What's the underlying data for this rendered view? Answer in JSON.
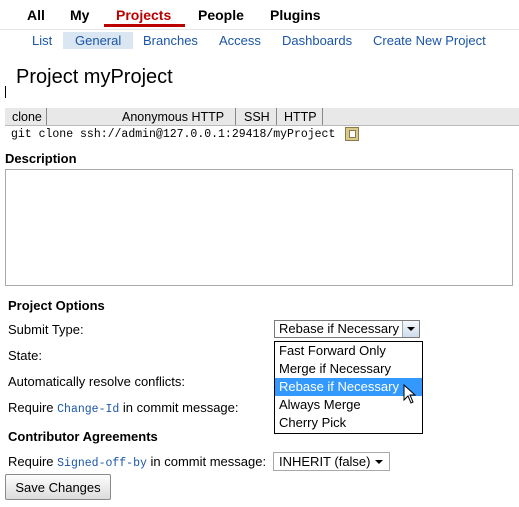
{
  "topnav": {
    "tabs": [
      "All",
      "My",
      "Projects",
      "People",
      "Plugins"
    ],
    "active": "Projects"
  },
  "subnav": {
    "items": [
      "List",
      "General",
      "Branches",
      "Access",
      "Dashboards",
      "Create New Project"
    ],
    "active": "General"
  },
  "page_title": "Project myProject",
  "download": {
    "clone_label": "clone",
    "schemes": [
      "Anonymous HTTP",
      "SSH",
      "HTTP"
    ],
    "command": "git clone ssh://admin@127.0.0.1:29418/myProject",
    "copy_icon": "copy-clipboard-icon"
  },
  "description": {
    "label": "Description",
    "value": ""
  },
  "project_options": {
    "heading": "Project Options",
    "submit_type_label": "Submit Type:",
    "submit_type_value": "Rebase if Necessary",
    "state_label": "State:",
    "auto_resolve_label": "Automatically resolve conflicts:",
    "change_id_prefix": "Require",
    "change_id_code": "Change-Id",
    "change_id_suffix": "in commit message:",
    "submit_type_options": [
      "Fast Forward Only",
      "Merge if Necessary",
      "Rebase if Necessary",
      "Always Merge",
      "Cherry Pick"
    ],
    "highlighted_option": "Rebase if Necessary"
  },
  "contributor_agreements": {
    "heading": "Contributor Agreements",
    "signed_off_prefix": "Require",
    "signed_off_code": "Signed-off-by",
    "signed_off_suffix": "in commit message:",
    "signed_off_value": "INHERIT (false)"
  },
  "save_button": "Save Changes",
  "colors": {
    "active_tab": "#bb0000",
    "link": "#1a55a8",
    "subnav_active_bg": "#dbe6f3",
    "highlight": "#3399ff"
  }
}
